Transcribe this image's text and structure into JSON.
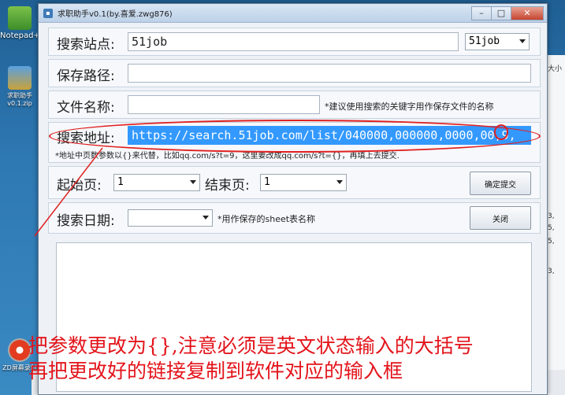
{
  "desktop": {
    "icons": [
      {
        "label": "Notepad++"
      },
      {
        "label": "求职助手v0.1.zip"
      },
      {
        "label": "ZD屏幕录制"
      }
    ]
  },
  "window": {
    "title": "求职助手v0.1(by.喜爱.zwg876)",
    "controls": {
      "minimize": "–",
      "maximize": "□",
      "close": "✕"
    }
  },
  "form": {
    "site": {
      "label": "搜索站点:",
      "value": "51job",
      "dropdown_value": "51job"
    },
    "path": {
      "label": "保存路径:",
      "value": ""
    },
    "filename": {
      "label": "文件名称:",
      "value": "",
      "note": "*建议使用搜索的关键字用作保存文件的名称"
    },
    "url": {
      "label": "搜索地址:",
      "value": "https://search.51job.com/list/040000,000000,0000,00,9,",
      "note": "*地址中页数参数以{}来代替，比如qq.com/s?t=9，这里要改成qq.com/s?t={}，再填上去提交."
    },
    "start_page": {
      "label": "起始页:",
      "value": "1"
    },
    "end_page": {
      "label": "结束页:",
      "value": "1"
    },
    "submit_button": "确定提交",
    "date": {
      "label": "搜索日期:",
      "value": "",
      "note": "*用作保存的sheet表名称"
    },
    "close_button": "关闭"
  },
  "annotation": {
    "line1": "把参数更改为{},注意必须是英文状态输入的大括号",
    "line2": "再把更改好的链接复制到软件对应的输入框"
  },
  "colors": {
    "annotation": "#e3141b",
    "selection": "#3399ff"
  }
}
